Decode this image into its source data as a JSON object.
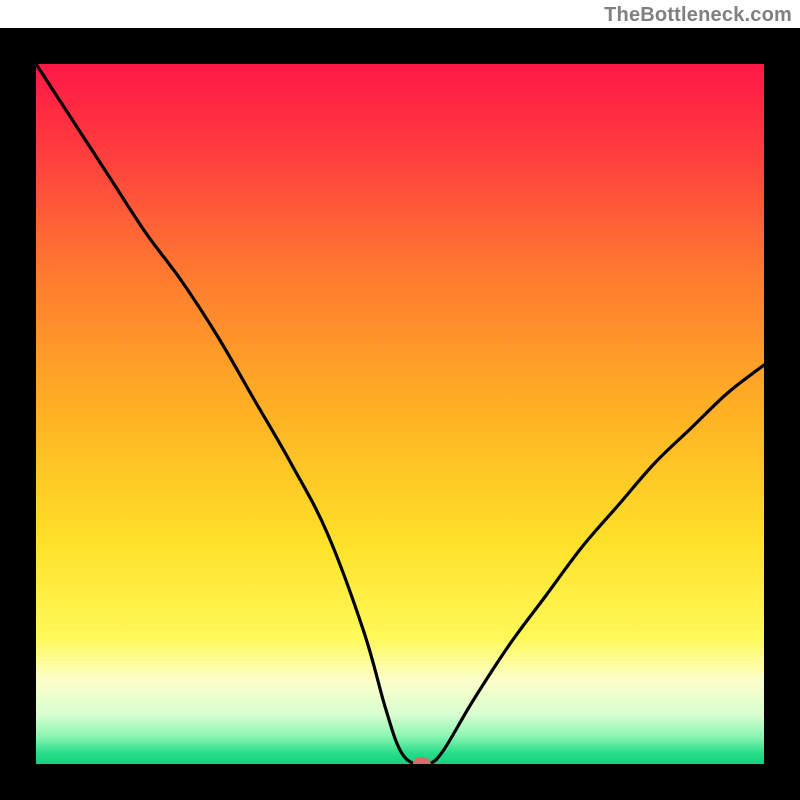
{
  "attribution": "TheBottleneck.com",
  "chart_data": {
    "type": "line",
    "title": "",
    "xlabel": "",
    "ylabel": "",
    "xlim": [
      0,
      100
    ],
    "ylim": [
      0,
      100
    ],
    "series": [
      {
        "name": "curve",
        "x": [
          0,
          5,
          10,
          15,
          20,
          25,
          30,
          35,
          40,
          45,
          48,
          50,
          52,
          54,
          56,
          60,
          65,
          70,
          75,
          80,
          85,
          90,
          95,
          100
        ],
        "y": [
          100,
          92,
          84,
          76,
          69,
          61,
          52,
          43,
          33,
          19,
          8,
          2,
          0,
          0,
          2,
          9,
          17,
          24,
          31,
          37,
          43,
          48,
          53,
          57
        ]
      }
    ],
    "marker": {
      "x": 53,
      "y": 0,
      "color": "#d96b6b"
    },
    "gradient_stops": [
      {
        "offset": 0.0,
        "color": "#ff1846"
      },
      {
        "offset": 0.12,
        "color": "#ff3b3f"
      },
      {
        "offset": 0.3,
        "color": "#ff7a30"
      },
      {
        "offset": 0.5,
        "color": "#ffb224"
      },
      {
        "offset": 0.68,
        "color": "#ffe028"
      },
      {
        "offset": 0.82,
        "color": "#fff95a"
      },
      {
        "offset": 0.88,
        "color": "#fdffca"
      },
      {
        "offset": 0.93,
        "color": "#d8ffd0"
      },
      {
        "offset": 0.96,
        "color": "#8cf5b2"
      },
      {
        "offset": 0.985,
        "color": "#26dd89"
      },
      {
        "offset": 1.0,
        "color": "#17cf7e"
      }
    ],
    "frame": {
      "stroke": "#000000",
      "width": 36
    }
  }
}
